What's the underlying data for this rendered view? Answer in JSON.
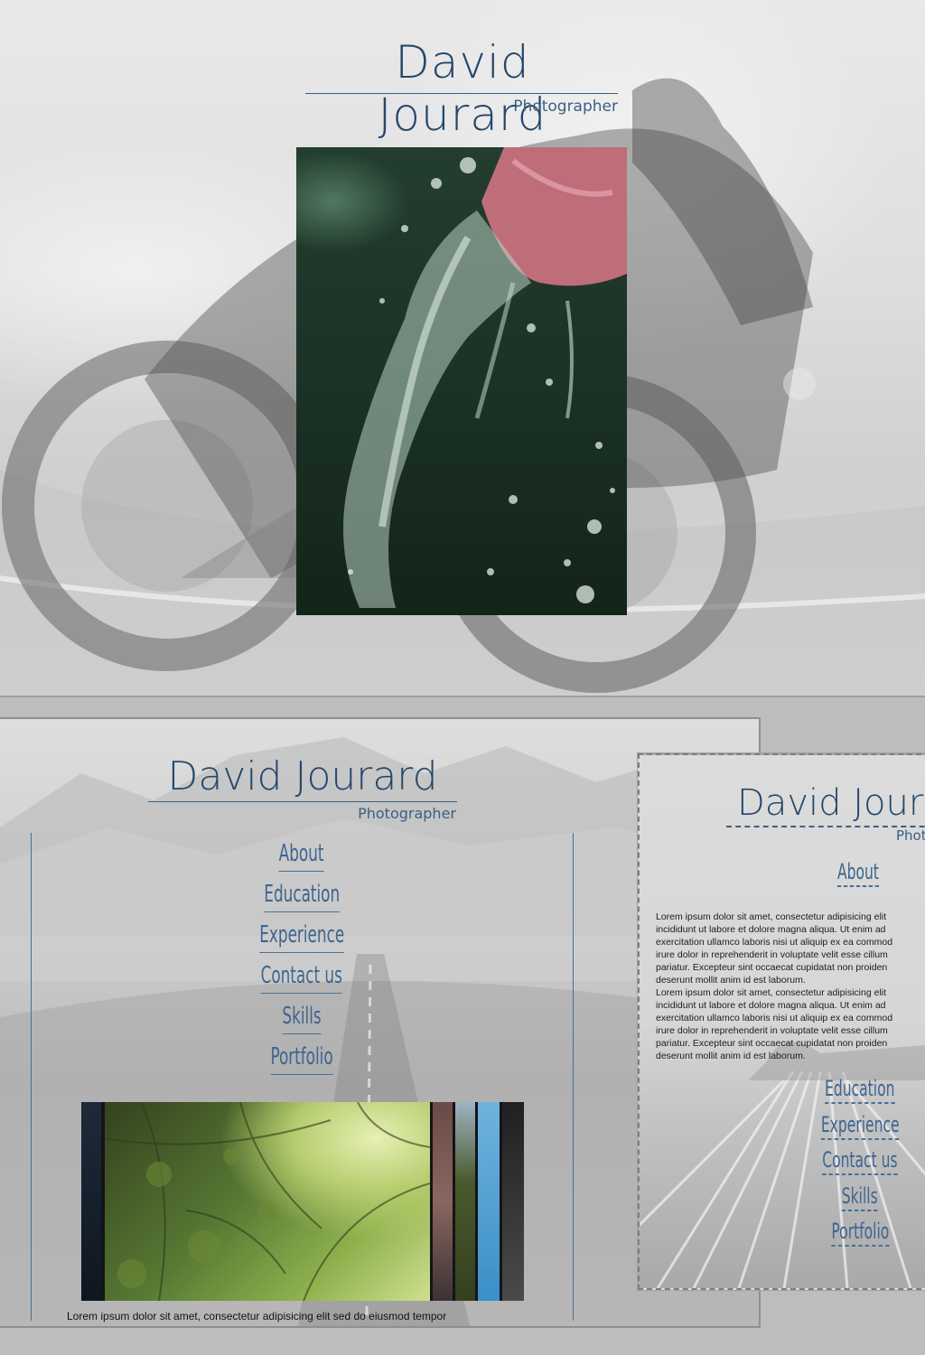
{
  "top": {
    "title": "David Jourard",
    "subtitle": "Photographer"
  },
  "mockup2": {
    "title": "David Jourard",
    "subtitle": "Photographer",
    "nav": [
      "About",
      "Education",
      "Experience",
      "Contact us",
      "Skills",
      "Portfolio"
    ],
    "footer_text": "Lorem ipsum dolor sit amet, consectetur adipisicing elit sed do eiusmod tempor"
  },
  "mockup3": {
    "title": "David Joura",
    "subtitle": "Phot",
    "about": "About",
    "body": [
      "Lorem ipsum dolor sit amet, consectetur adipisicing elit",
      "incididunt ut labore et dolore magna aliqua. Ut enim ad",
      "exercitation ullamco laboris nisi ut aliquip ex ea commod",
      "irure dolor in reprehenderit in voluptate velit esse cillum",
      "pariatur. Excepteur sint occaecat cupidatat non proiden",
      "deserunt mollit anim id est laborum.",
      "Lorem ipsum dolor sit amet, consectetur adipisicing elit",
      "incididunt ut labore et dolore magna aliqua. Ut enim ad",
      "exercitation ullamco laboris nisi ut aliquip ex ea commod",
      "irure dolor in reprehenderit in voluptate velit esse cillum",
      "pariatur. Excepteur sint occaecat cupidatat non proiden",
      "deserunt mollit anim id est laborum."
    ],
    "nav": [
      "Education",
      "Experience",
      "Contact us",
      "Skills",
      "Portfolio"
    ]
  }
}
